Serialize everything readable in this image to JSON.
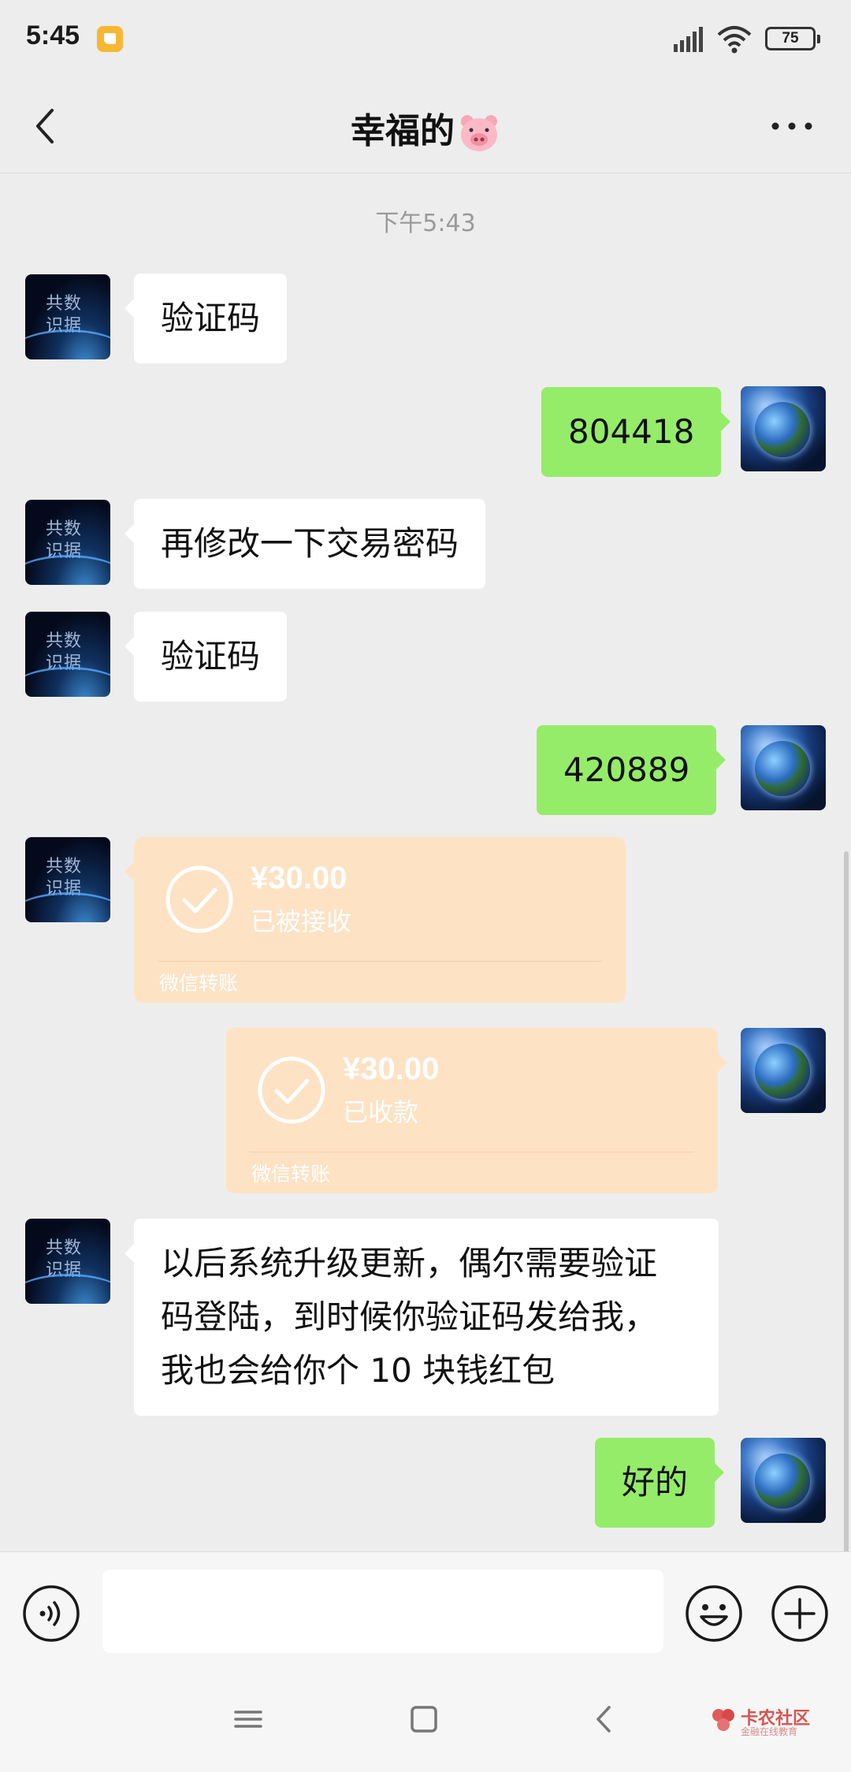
{
  "status_bar": {
    "time": "5:45",
    "battery": "75"
  },
  "header": {
    "title": "幸福的"
  },
  "chat": {
    "timestamp": "下午5:43",
    "messages": [
      {
        "side": "in",
        "text": "验证码"
      },
      {
        "side": "out",
        "text": "804418"
      },
      {
        "side": "in",
        "text": "再修改一下交易密码"
      },
      {
        "side": "in",
        "text": "验证码"
      },
      {
        "side": "out",
        "text": "420889"
      },
      {
        "side": "in",
        "type": "transfer",
        "amount": "¥30.00",
        "status": "已被接收",
        "footer": "微信转账"
      },
      {
        "side": "out",
        "type": "transfer",
        "amount": "¥30.00",
        "status": "已收款",
        "footer": "微信转账"
      },
      {
        "side": "in",
        "lines": [
          "以后系统升级更新，偶尔需要验证",
          "码登陆，到时候你验证码发给我，",
          "我也会给你个 10 块钱红包"
        ]
      },
      {
        "side": "out",
        "text": "好的"
      }
    ]
  },
  "input_bar": {
    "value": "",
    "icons": [
      "voice-icon",
      "emoji-icon",
      "plus-icon"
    ]
  },
  "nav_bar": {
    "icons": [
      "menu-icon",
      "home-icon",
      "back-icon"
    ]
  },
  "watermark": {
    "title": "卡农社区",
    "subtitle": "金融在线教育"
  },
  "colors": {
    "background": "#ededed",
    "outgoing_bubble": "#95ec69",
    "incoming_bubble": "#ffffff",
    "transfer_card": "#fde2c4"
  }
}
